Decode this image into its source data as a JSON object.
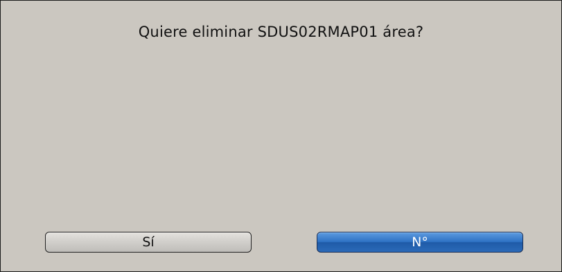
{
  "dialog": {
    "message": "Quiere eliminar SDUS02RMAP01 área?",
    "buttons": {
      "yes_label": "Sí",
      "no_label": "N°"
    },
    "colors": {
      "background": "#cbc7c0",
      "selected_button": "#2f72c4"
    }
  }
}
